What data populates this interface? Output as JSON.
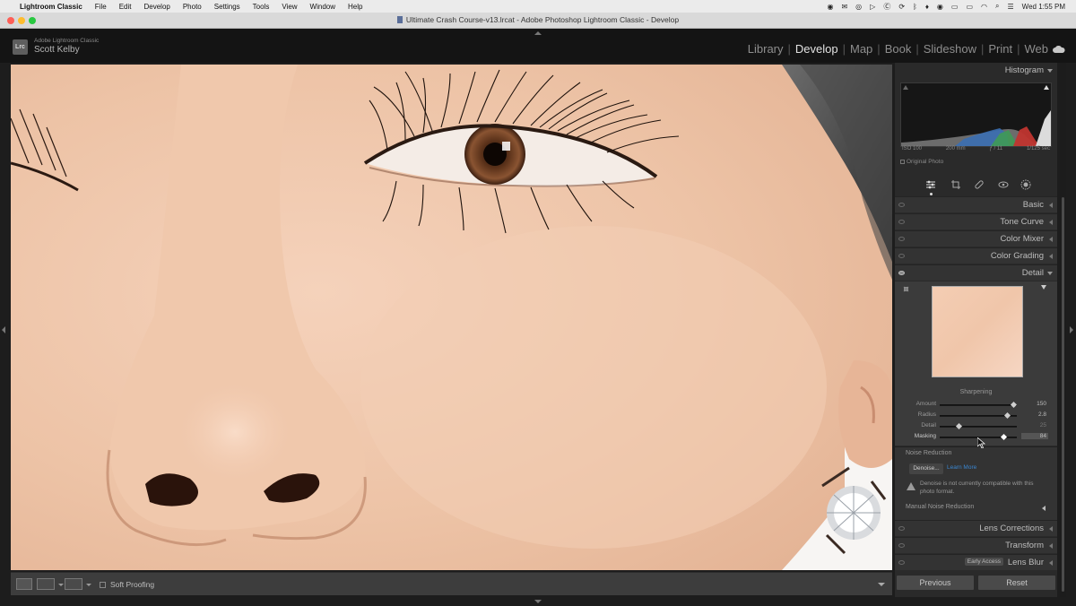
{
  "menubar": {
    "app_name": "Lightroom Classic",
    "items": [
      "File",
      "Edit",
      "Develop",
      "Photo",
      "Settings",
      "Tools",
      "View",
      "Window",
      "Help"
    ],
    "clock": "Wed 1:55 PM"
  },
  "window": {
    "title": "Ultimate Crash Course-v13.lrcat - Adobe Photoshop Lightroom Classic - Develop"
  },
  "identity": {
    "logo": "Lrc",
    "product": "Adobe Lightroom Classic",
    "user": "Scott Kelby"
  },
  "modules": {
    "items": [
      "Library",
      "Develop",
      "Map",
      "Book",
      "Slideshow",
      "Print",
      "Web"
    ],
    "active": "Develop",
    "separator": "|"
  },
  "histogram": {
    "label": "Histogram",
    "iso": "ISO 100",
    "focal": "200 mm",
    "aperture": "ƒ / 11",
    "shutter": "1/125 sec",
    "original_photo": "Original Photo"
  },
  "panels": {
    "basic": "Basic",
    "tone_curve": "Tone Curve",
    "color_mixer": "Color Mixer",
    "color_grading": "Color Grading",
    "detail": "Detail",
    "lens_corrections": "Lens Corrections",
    "transform": "Transform",
    "lens_blur": "Lens Blur",
    "early_access": "Early Access"
  },
  "sharpening": {
    "title": "Sharpening",
    "amount_label": "Amount",
    "amount": "150",
    "amount_pos": 0.96,
    "radius_label": "Radius",
    "radius": "2.8",
    "radius_pos": 0.88,
    "detail_label": "Detail",
    "detail": "25",
    "detail_pos": 0.25,
    "masking_label": "Masking",
    "masking": "84",
    "masking_pos": 0.84
  },
  "noise_reduction": {
    "title": "Noise Reduction",
    "denoise_button": "Denoise...",
    "learn_more": "Learn More",
    "warning": "Denoise is not currently compatible with this photo format.",
    "manual": "Manual Noise Reduction"
  },
  "toolbar": {
    "soft_proofing": "Soft Proofing"
  },
  "buttons": {
    "previous": "Previous",
    "reset": "Reset"
  }
}
